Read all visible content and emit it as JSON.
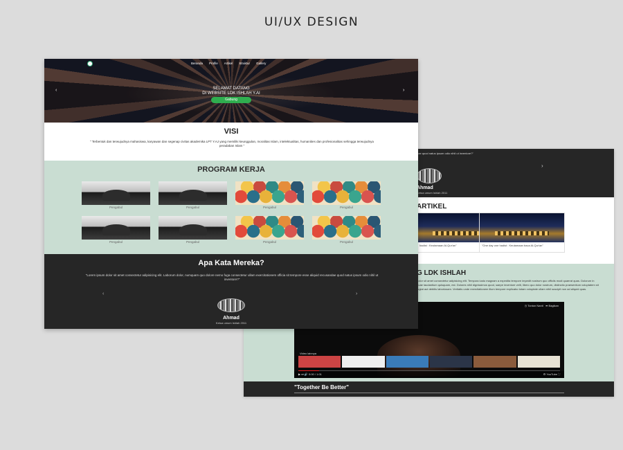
{
  "heading": "UI/UX DESIGN",
  "front": {
    "nav": {
      "items": [
        "Beranda",
        "Profile",
        "Artikel",
        "Struktur",
        "Gallery"
      ]
    },
    "hero": {
      "line1": "SELAMAT DATANG",
      "line2": "DI WEBSITE LDK ISHLAH Y.AI",
      "button": "Gabung",
      "prev_arrow": "‹",
      "next_arrow": "›"
    },
    "visi": {
      "title": "VISI",
      "text": "\" Terbentuk dan terwujudnya mahasiswa, karyawan dan segenap civitas akademika LPT Y.AJ yang memiliki keunggulan, moralitas Islam, intelektualitas, humanities dan profesionalitas sehingga terwujudnya peradaban Islam \""
    },
    "program": {
      "title": "PROGRAM KERJA",
      "tiles": [
        {
          "caption": "Pengabul",
          "image": "prayer"
        },
        {
          "caption": "Pengabul",
          "image": "prayer"
        },
        {
          "caption": "Pengabul",
          "image": "scales"
        },
        {
          "caption": "Pengabul",
          "image": "scales"
        },
        {
          "caption": "Pengabul",
          "image": "prayer"
        },
        {
          "caption": "Pengabul",
          "image": "prayer"
        },
        {
          "caption": "Pengabul",
          "image": "scales"
        },
        {
          "caption": "Pengabul",
          "image": "scales"
        }
      ]
    },
    "testimonial": {
      "title": "Apa Kata Mereka?",
      "quote": "\"Lorem ipsum dolor sit amet consectetur adipisicing elit. Laborum dolor, numquam quo dolore nemo fuga consectetur ullam exercitationem officia sit tempore esse aliquid recusandae quod natus ipsum odio nihil ut inventore?\"",
      "prev_arrow": "‹",
      "next_arrow": "›",
      "name": "Ahmad",
      "role": "Ketua umum Ishlah 2011"
    }
  },
  "back": {
    "testimonial": {
      "quote_tail": "dae quod natus ipsum odio nihil ut inventore?\"",
      "name": "Ahmad",
      "role": "Ketua umum Ishlah 2011",
      "next_arrow": "›"
    },
    "artikel": {
      "title": "ARTIKEL",
      "cards": [
        {
          "caption": "hadist : Keutamaan Al-Qur'an\""
        },
        {
          "caption": "\"One day one hadist : Keutamaan baca Al-Qur'an\""
        }
      ]
    },
    "ldk": {
      "title": "G LDK ISHLAH",
      "text": "dolor sit amet consectetur adipisicing elit. Tempora iusto magnam a expedita tempore impedit nostrum quo officiis modi quaerat quas. Dolorum in quae laudantium quisquam, est. Dolores nihil dignissimos quod, saepe inventore velit, libero quo dolor nostrum, distinctio praesentium voluptatem sit fugiat aut debitis laboriosam. Veritatis unde exercitationem illum tempore explicabo totam voluptate ullam nihil suscipit non ad aliquid quas."
    },
    "video": {
      "watch_later": "Tonton Nanti",
      "share": "Bagikan",
      "more_label": "Video lainnya",
      "time": "0:00 / 1:01",
      "youtube": "YouTube"
    },
    "footer": "\"Together Be Better\""
  }
}
